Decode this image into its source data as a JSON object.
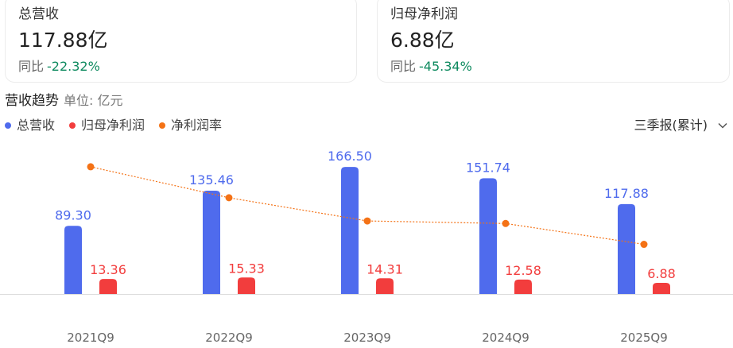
{
  "cards": [
    {
      "title": "总营收",
      "value": "117.88亿",
      "change_label": "同比",
      "change_value": "-22.32%"
    },
    {
      "title": "归母净利润",
      "value": "6.88亿",
      "change_label": "同比",
      "change_value": "-45.34%"
    }
  ],
  "section": {
    "title": "营收趋势",
    "unit": "单位: 亿元"
  },
  "period_select": {
    "value": "三季报(累计)"
  },
  "colors": {
    "revenue": "#4f6bed",
    "profit": "#f23d3d",
    "margin": "#f47216",
    "positive_change": "#0e8a5f"
  },
  "chart_data": {
    "type": "bar",
    "categories": [
      "2021Q9",
      "2022Q9",
      "2023Q9",
      "2024Q9",
      "2025Q9"
    ],
    "series": [
      {
        "name": "总营收",
        "type": "bar",
        "values": [
          89.3,
          135.46,
          166.5,
          151.74,
          117.88
        ]
      },
      {
        "name": "归母净利润",
        "type": "bar",
        "values": [
          13.36,
          15.33,
          14.31,
          12.58,
          6.88
        ]
      },
      {
        "name": "净利润率",
        "type": "line",
        "values": [
          14.96,
          11.32,
          8.59,
          8.29,
          5.84
        ]
      }
    ],
    "ylim": [
      0,
      180
    ],
    "margin_ylim": [
      0,
      18
    ],
    "grid": false,
    "legend": "top-left",
    "data_labels": true
  }
}
